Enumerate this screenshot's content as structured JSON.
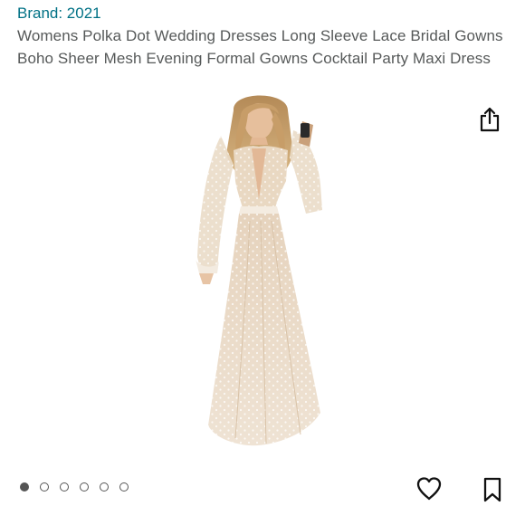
{
  "brand": {
    "label": "Brand: 2021"
  },
  "product": {
    "title": "Womens Polka Dot Wedding Dresses Long Sleeve Lace Bridal Gowns Boho Sheer Mesh Evening Formal Gowns Cocktail Party Maxi Dress",
    "image_icon": "dress-photo"
  },
  "carousel": {
    "total": 6,
    "active_index": 0
  },
  "actions": {
    "share_icon": "share-icon",
    "wishlist_icon": "heart-icon",
    "save_icon": "bookmark-icon"
  },
  "colors": {
    "link": "#007185",
    "title_text": "#565959",
    "icon": "#111111"
  }
}
